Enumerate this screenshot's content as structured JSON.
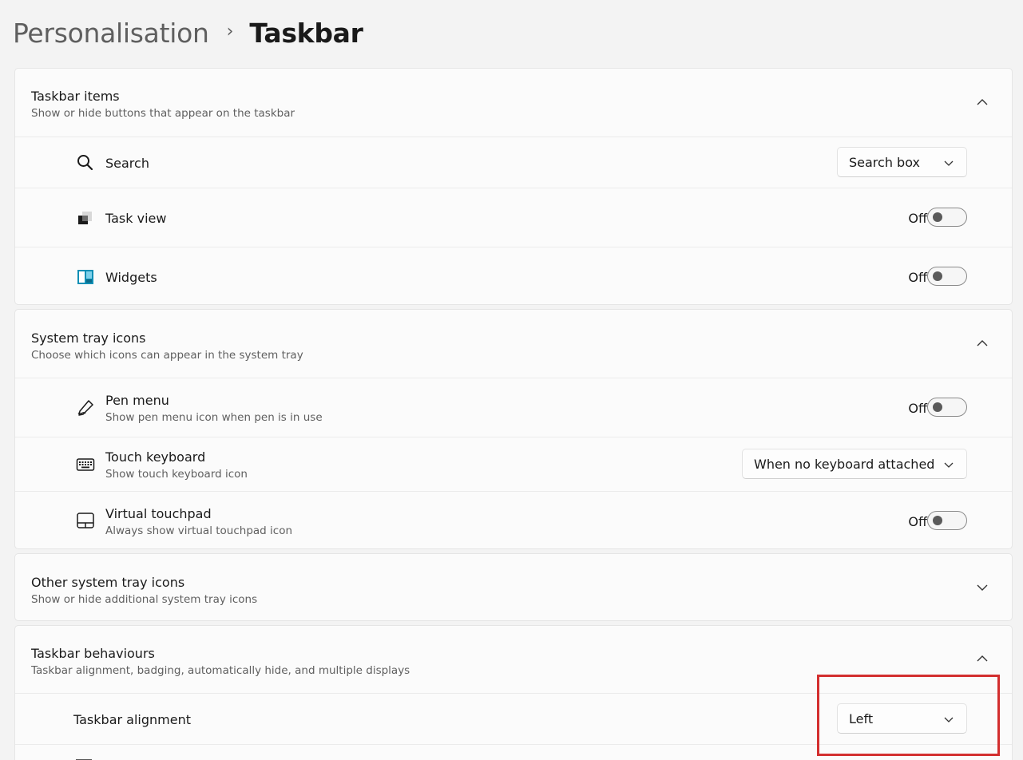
{
  "breadcrumb": {
    "parent": "Personalisation",
    "separator": "›",
    "current": "Taskbar"
  },
  "taskbar_items": {
    "title": "Taskbar items",
    "subtitle": "Show or hide buttons that appear on the taskbar",
    "expanded": true,
    "rows": [
      {
        "label": "Search",
        "icon": "search-icon",
        "control": "dropdown",
        "value": "Search box"
      },
      {
        "label": "Task view",
        "icon": "task-view-icon",
        "control": "toggle",
        "state": "Off"
      },
      {
        "label": "Widgets",
        "icon": "widgets-icon",
        "control": "toggle",
        "state": "Off"
      }
    ]
  },
  "system_tray": {
    "title": "System tray icons",
    "subtitle": "Choose which icons can appear in the system tray",
    "expanded": true,
    "rows": [
      {
        "label": "Pen menu",
        "sub": "Show pen menu icon when pen is in use",
        "icon": "pen-icon",
        "control": "toggle",
        "state": "Off"
      },
      {
        "label": "Touch keyboard",
        "sub": "Show touch keyboard icon",
        "icon": "keyboard-icon",
        "control": "dropdown",
        "value": "When no keyboard attached"
      },
      {
        "label": "Virtual touchpad",
        "sub": "Always show virtual touchpad icon",
        "icon": "touchpad-icon",
        "control": "toggle",
        "state": "Off"
      }
    ]
  },
  "other_tray": {
    "title": "Other system tray icons",
    "subtitle": "Show or hide additional system tray icons",
    "expanded": false
  },
  "behaviours": {
    "title": "Taskbar behaviours",
    "subtitle": "Taskbar alignment, badging, automatically hide, and multiple displays",
    "expanded": true,
    "rows": [
      {
        "label": "Taskbar alignment",
        "control": "dropdown",
        "value": "Left"
      }
    ]
  },
  "colors": {
    "highlight": "#d32f2f",
    "widgets_accent": "#0f8fb5"
  }
}
